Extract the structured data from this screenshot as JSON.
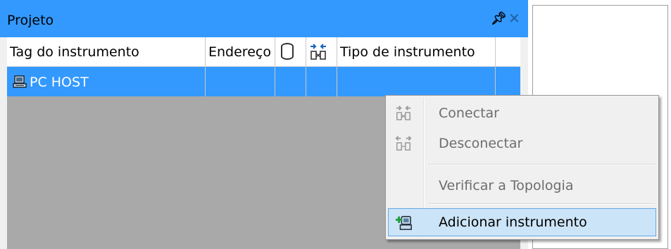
{
  "panel": {
    "title": "Projeto",
    "pin_icon": "pin-icon",
    "close_icon": "close-icon"
  },
  "columns": [
    {
      "label": "Tag do instrumento"
    },
    {
      "label": "Endereço"
    },
    {
      "icon": "database-icon"
    },
    {
      "icon": "connect-icon"
    },
    {
      "label": "Tipo de instrumento"
    }
  ],
  "rows": [
    {
      "tag": "PC HOST",
      "icon": "computer-icon"
    }
  ],
  "context_menu": {
    "items": [
      {
        "label": "Conectar",
        "icon": "connect-icon",
        "enabled": false
      },
      {
        "label": "Desconectar",
        "icon": "disconnect-icon",
        "enabled": false
      },
      {
        "label": "Verificar a Topologia",
        "enabled": false
      },
      {
        "label": "Adicionar instrumento",
        "icon": "add-instrument-icon",
        "enabled": true
      }
    ]
  },
  "colors": {
    "selection": "#3399ff",
    "menu_hover": "#cce4f7",
    "area_background": "#a9a9a9"
  }
}
